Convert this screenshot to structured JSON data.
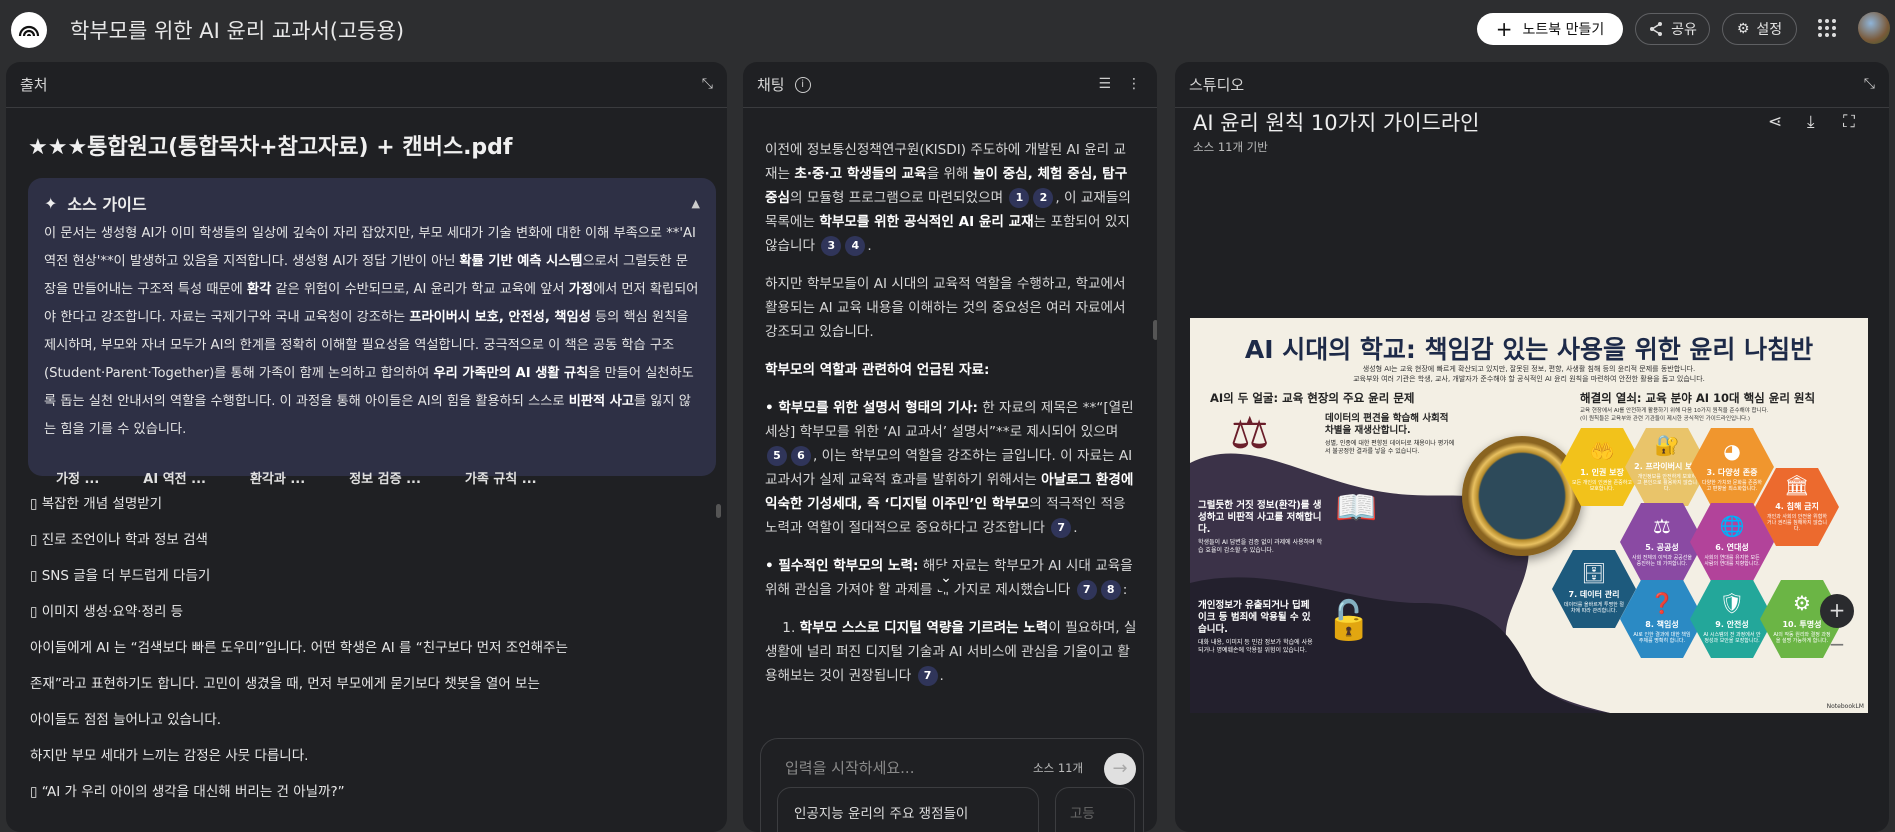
{
  "header": {
    "title": "학부모를 위한 AI 윤리 교과서(고등용)",
    "new_notebook": "노트북 만들기",
    "share": "공유",
    "settings": "설정"
  },
  "sources": {
    "panel_title": "출처",
    "pdf_title": "★★★통합원고(통합목차+참고자료) + 캔버스.pdf",
    "guide": {
      "title": "소스 가이드",
      "body": [
        {
          "t": "이 문서는 생성형 AI가 이미 학생들의 일상에 깊숙이 자리 잡았지만, 부모 세대가 기술 변화에 대한 이해 부족으로 **'AI 역전 현상'**이 발생하고 있음을 지적합니다. 생성형 AI가 정답 기반이 아닌 "
        },
        {
          "t": "확률 기반 예측 시스템",
          "b": true
        },
        {
          "t": "으로서 그럴듯한 문장을 만들어내는 구조적 특성 때문에 "
        },
        {
          "t": "환각",
          "b": true
        },
        {
          "t": " 같은 위험이 수반되므로, AI 윤리가 학교 교육에 앞서 "
        },
        {
          "t": "가정",
          "b": true
        },
        {
          "t": "에서 먼저 확립되어야 한다고 강조합니다. 자료는 국제기구와 국내 교육청이 강조하는 "
        },
        {
          "t": "프라이버시 보호, 안전성, 책임성",
          "b": true
        },
        {
          "t": " 등의 핵심 원칙을 제시하며, 부모와 자녀 모두가 AI의 한계를 정확히 이해할 필요성을 역설합니다. 궁극적으로 이 책은 공동 학습 구조(Student·Parent·Together)를 통해 가족이 함께 논의하고 합의하여 "
        },
        {
          "t": "우리 가족만의 AI 생활 규칙",
          "b": true
        },
        {
          "t": "을 만들어 실천하도록 돕는 실천 안내서의 역할을 수행합니다. 이 과정을 통해 아이들은 AI의 힘을 활용하되 스스로 "
        },
        {
          "t": "비판적 사고",
          "b": true
        },
        {
          "t": "를 잃지 않는 힘을 기를 수 있습니다."
        }
      ],
      "chips": [
        "가정 ...",
        "AI 역전 ...",
        "환각과 ...",
        "정보 검증 ...",
        "가족 규칙 ..."
      ]
    },
    "content": [
      "▯ 복잡한 개념 설명받기",
      "▯ 진로 조언이나 학과 정보 검색",
      "▯ SNS 글을 더 부드럽게 다듬기",
      "▯ 이미지 생성·요약·정리 등",
      "아이들에게 AI 는 “검색보다 빠른 도우미”입니다. 어떤 학생은 AI 를 “친구보다 먼저 조언해주는",
      "존재”라고 표현하기도 합니다. 고민이 생겼을 때, 먼저 부모에게 묻기보다 챗봇을 열어 보는",
      "아이들도 점점 늘어나고 있습니다.",
      "하지만 부모 세대가 느끼는 감정은 사뭇 다릅니다.",
      "▯ “AI 가 우리 아이의 생각을 대신해 버리는 건 아닐까?”"
    ]
  },
  "chat": {
    "panel_title": "채팅",
    "paragraphs": [
      [
        {
          "t": "이전에 정보통신정책연구원(KISDI) 주도하에 개발된 AI 윤리 교재는 "
        },
        {
          "t": "초·중·고 학생들의 교육",
          "b": true
        },
        {
          "t": "을 위해 "
        },
        {
          "t": "놀이 중심, 체험 중심, 탐구 중심",
          "b": true
        },
        {
          "t": "의 모듈형 프로그램으로 마련되었으며 "
        },
        {
          "c": "1"
        },
        {
          "c": "2"
        },
        {
          "t": ", 이 교재들의 목록에는 "
        },
        {
          "t": "학부모를 위한 공식적인 AI 윤리 교재",
          "b": true
        },
        {
          "t": "는 포함되어 있지 않습니다 "
        },
        {
          "c": "3"
        },
        {
          "c": "4"
        },
        {
          "t": "."
        }
      ],
      [
        {
          "t": "하지만 학부모들이 AI 시대의 교육적 역할을 수행하고, 학교에서 활용되는 AI 교육 내용을 이해하는 것의 중요성은 여러 자료에서 강조되고 있습니다."
        }
      ],
      [
        {
          "t": "학부모의 역할과 관련하여 언급된 자료:",
          "b": true
        }
      ],
      [
        {
          "t": "• 학부모를 위한 설명서 형태의 기사:",
          "b": true
        },
        {
          "t": " 한 자료의 제목은 **“[열린세상] 학부모를 위한 ‘AI 교과서’ 설명서”**로 제시되어 있으며 "
        },
        {
          "c": "5"
        },
        {
          "c": "6"
        },
        {
          "t": ", 이는 학부모의 역할을 강조하는 글입니다. 이 자료는 AI 교과서가 실제 교육적 효과를 발휘하기 위해서는 "
        },
        {
          "t": "아날로그 환경에 익숙한 기성세대, 즉 ‘디지털 이주민’인 학부모",
          "b": true
        },
        {
          "t": "의 적극적인 적응 노력과 역할이 절대적으로 중요하다고 강조합니다 "
        },
        {
          "c": "7"
        },
        {
          "t": "."
        }
      ],
      [
        {
          "t": "• 필수적인 학부모의 노력:",
          "b": true
        },
        {
          "t": " 해당 자료는 학부모가 AI 시대 교육을 위해 관심을 가져야 할 과제를 네 가지로 제시했습니다 "
        },
        {
          "c": "7"
        },
        {
          "c": "8"
        },
        {
          "t": ":"
        }
      ],
      [
        {
          "t": "    1. "
        },
        {
          "t": "학부모 스스로 디지털 역량을 기르려는 노력",
          "b": true
        },
        {
          "t": "이 필요하며, 실생활에 널리 퍼진 디지털 기술과 AI 서비스에 관심을 기울이고 활용해보는 것이 권장됩니다 "
        },
        {
          "c": "7"
        },
        {
          "t": "."
        }
      ]
    ],
    "input_placeholder": "입력을 시작하세요...",
    "source_count": "소스 11개",
    "suggestions": [
      "인공지능 윤리의 주요 쟁점들이",
      "고등"
    ]
  },
  "studio": {
    "panel_title": "스튜디오",
    "title": "AI 윤리 원칙 10가지 가이드라인",
    "subtitle": "소스 11개 기반",
    "infographic": {
      "title": "AI 시대의 학교: 책임감 있는 사용을 위한 윤리 나침반",
      "subtitle": [
        "생성형 AI는 교육 현장에 빠르게 확산되고 있지만, 잘못된 정보, 편향, 사생활 침해 등의 윤리적 문제를 동반합니다.",
        "교육부와 여러 기관은 학생, 교사, 개발자가 준수해야 할 공식적인 AI 윤리 원칙을 마련하여 안전한 활용을 돕고 있습니다."
      ],
      "left_heading": "AI의 두 얼굴: 교육 현장의 주요 윤리 문제",
      "issues": [
        {
          "h": "데이터의 편견을 학습해 사회적 차별을 재생산합니다.",
          "d": "성별, 인종에 대한 편향된 데이터로 채용이나 평가에서 불공정한 결과를 낳을 수 있습니다."
        },
        {
          "h": "그럴듯한 거짓 정보(환각)를 생성하고 비판적 사고를 저해합니다.",
          "d": "학생들이 AI 답변을 검증 없이 과제에 사용하며 학습 효율이 감소할 수 있습니다."
        },
        {
          "h": "개인정보가 유출되거나 딥페이크 등 범죄에 악용될 수 있습니다.",
          "d": "대화 내용, 이미지 등 민감 정보가 학습에 사용되거나 명예훼손에 악용될 위험이 있습니다."
        }
      ],
      "right_heading": "해결의 열쇠: 교육 분야 AI 10대 핵심 윤리 원칙",
      "right_sub": [
        "교육 현장에서 AI를 안전하게 활용하기 위해 다음 10가지 원칙을 준수해야 합니다.",
        "(이 원칙들은 교육부와 관련 기관들이 제시한 공식적인 가이드라인입니다.)"
      ],
      "principles": [
        {
          "n": "1. 인권 보장",
          "d": "모든 개인의 인권을 존중하고 보호합니다.",
          "color": "#f2c21b"
        },
        {
          "n": "2. 프라이버시 보호",
          "d": "개인정보를 안전하게 보호하고 본인으로 활용하지 않습니다.",
          "color": "#e9c46a"
        },
        {
          "n": "3. 다양성 존중",
          "d": "다양한 가치와 문화를 존중하고 편향을 최소화합니다.",
          "color": "#f0962e"
        },
        {
          "n": "4. 침해 금지",
          "d": "개인과 사회의 안전을 위협하거나 권리를 침해하지 않습니다.",
          "color": "#ec6a2e"
        },
        {
          "n": "5. 공공성",
          "d": "사회 전체의 이익과 공공선을 증진하는 데 기여합니다.",
          "color": "#8a4aa3"
        },
        {
          "n": "6. 연대성",
          "d": "사회의 연대를 유지한 모든 사람의 연대를 지향합니다.",
          "color": "#b2439a"
        },
        {
          "n": "7. 데이터 관리",
          "d": "데이터를 올바르게 투명한 절차에 따라 관리합니다.",
          "color": "#1d5a7d"
        },
        {
          "n": "8. 책임성",
          "d": "AI로 인한 결과에 대한 책임 주체를 명확히 합니다.",
          "color": "#2b8ac4"
        },
        {
          "n": "9. 안전성",
          "d": "AI 시스템의 전 과정에서 안정성과 보안을 보장합니다.",
          "color": "#23a79a"
        },
        {
          "n": "10. 투명성",
          "d": "AI의 작동 원리와 결정 과정을 설명 가능하게 합니다.",
          "color": "#6bb545"
        }
      ],
      "watermark": "NotebookLM"
    }
  }
}
